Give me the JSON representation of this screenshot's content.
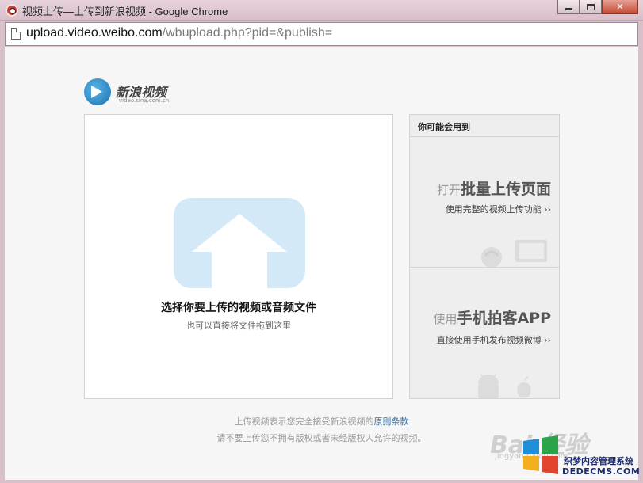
{
  "window": {
    "title": "视频上传—上传到新浪视频 - Google Chrome",
    "buttons": {
      "minimize": "",
      "maximize": "",
      "close": "✕"
    }
  },
  "address": {
    "host": "upload.video.weibo.com",
    "path": "/wbupload.php?pid=&publish="
  },
  "logo": {
    "name": "新浪视频",
    "domain": "video.sina.com.cn"
  },
  "upload": {
    "main_label": "选择你要上传的视频或音频文件",
    "sub_label": "也可以直接将文件拖到这里"
  },
  "side": {
    "header": "你可能会用到",
    "items": [
      {
        "prefix": "打开",
        "title": "批量上传页面",
        "desc": "使用完整的视频上传功能",
        "arrow": "››"
      },
      {
        "prefix": "使用",
        "title": "手机拍客APP",
        "desc": "直接使用手机发布视频微博",
        "arrow": "››"
      }
    ]
  },
  "footer": {
    "line1_prefix": "上传视频表示您完全接受新浪视频的",
    "line1_link": "原则条款",
    "line2": "请不要上传您不拥有版权或者未经版权人允许的视频。"
  },
  "watermarks": {
    "baidu": "Bai 经验",
    "jingyan": "jingyan.baidu.com",
    "brand_line1": "织梦内容管理系统",
    "brand_line2": "DEDECMS.COM"
  },
  "colors": {
    "accent": "#2a72b5",
    "upload_icon": "#d4e9f7"
  }
}
